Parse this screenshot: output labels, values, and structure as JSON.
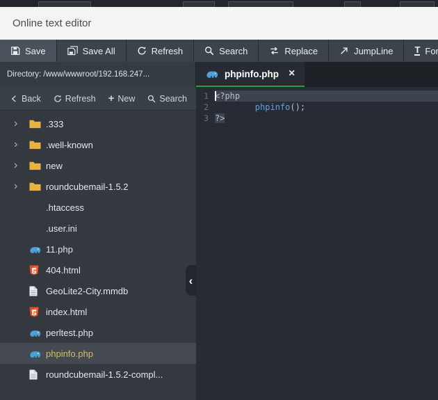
{
  "window": {
    "title": "Online text editor"
  },
  "toolbar": {
    "buttons": [
      {
        "label": "Save"
      },
      {
        "label": "Save All"
      },
      {
        "label": "Refresh"
      },
      {
        "label": "Search"
      },
      {
        "label": "Replace"
      },
      {
        "label": "JumpLine"
      },
      {
        "label": "Font"
      }
    ],
    "font_glyph": "T"
  },
  "directory": {
    "label": "Directory: /www/wwwroot/192.168.247..."
  },
  "tabs": [
    {
      "label": "phpinfo.php",
      "close_glyph": "×",
      "active": true
    }
  ],
  "file_toolbar": {
    "back": "Back",
    "refresh": "Refresh",
    "new": "New",
    "new_glyph": "+",
    "search": "Search"
  },
  "tree": {
    "chevron_glyph": "›",
    "items": [
      {
        "name": ".333",
        "type": "folder"
      },
      {
        "name": ".well-known",
        "type": "folder"
      },
      {
        "name": "new",
        "type": "folder"
      },
      {
        "name": "roundcubemail-1.5.2",
        "type": "folder"
      },
      {
        "name": ".htaccess",
        "type": "plain"
      },
      {
        "name": ".user.ini",
        "type": "plain"
      },
      {
        "name": "11.php",
        "type": "php"
      },
      {
        "name": "404.html",
        "type": "html"
      },
      {
        "name": "GeoLite2-City.mmdb",
        "type": "doc"
      },
      {
        "name": "index.html",
        "type": "html"
      },
      {
        "name": "perltest.php",
        "type": "php"
      },
      {
        "name": "phpinfo.php",
        "type": "php",
        "selected": true
      },
      {
        "name": "roundcubemail-1.5.2-compl...",
        "type": "doc"
      }
    ]
  },
  "panel": {
    "collapse_glyph": "‹"
  },
  "editor": {
    "line_numbers": [
      "1",
      "2",
      "3"
    ],
    "line1": "<?php",
    "line2_indent": "        ",
    "line2_func": "phpinfo",
    "line2_rest": "();",
    "line3": "?>"
  },
  "colors": {
    "accent_green": "#20a53a",
    "php_blue": "#4e9fd4",
    "folder_yellow": "#e8b33c",
    "html_orange": "#e44d26",
    "selected_file_text": "#d3bc66",
    "active_line_bg": "#3d4351"
  }
}
